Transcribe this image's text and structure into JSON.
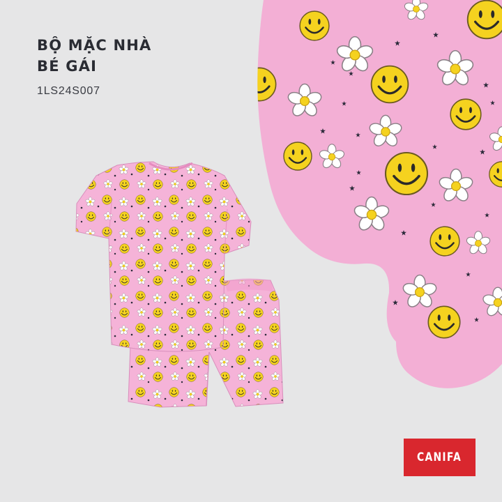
{
  "product": {
    "title_line1": "BỘ MẶC NHÀ",
    "title_line2": "BÉ GÁI",
    "sku": "1LS24S007"
  },
  "brand": {
    "logo_text": "CANIFA",
    "logo_color": "#d9272e"
  },
  "colors": {
    "background": "#e6e6e7",
    "fabric_pink": "#f5b3d8",
    "smiley_yellow": "#f5d21f",
    "daisy_white": "#ffffff"
  },
  "images": {
    "pajama_set": "pink-smiley-daisy-pajama-illustration",
    "fabric_closeup": "smiley-daisy-print-closeup"
  }
}
